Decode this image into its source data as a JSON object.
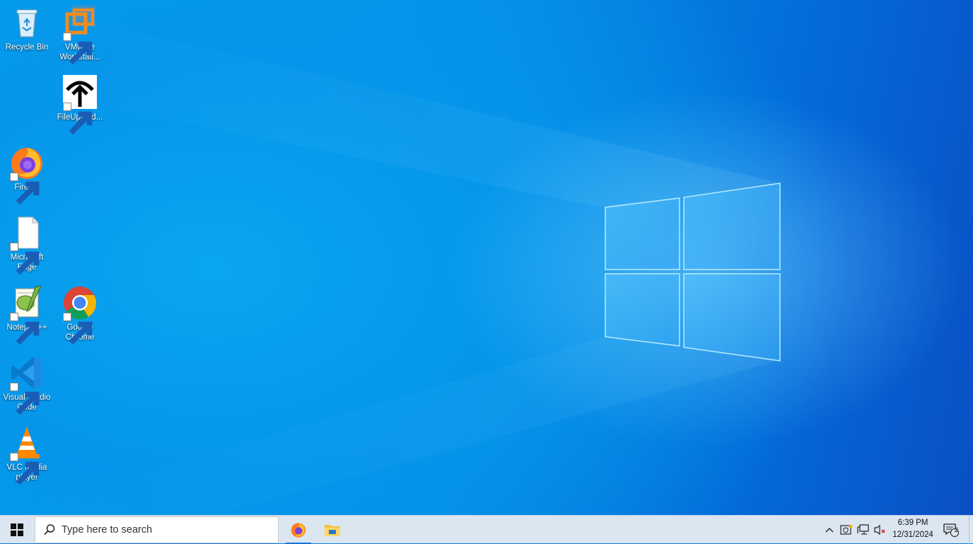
{
  "desktop": {
    "icons": [
      {
        "id": "recycle-bin",
        "label": "Recycle Bin"
      },
      {
        "id": "vmware",
        "label": "VMware Workstati..."
      },
      {
        "id": "fileupload",
        "label": "FileUpload..."
      },
      {
        "id": "firefox",
        "label": "Firefox"
      },
      {
        "id": "edge",
        "label": "Microsoft Edge"
      },
      {
        "id": "notepadpp",
        "label": "Notepad++"
      },
      {
        "id": "chrome",
        "label": "Google Chrome"
      },
      {
        "id": "vscode",
        "label": "Visual Studio Code"
      },
      {
        "id": "vlc",
        "label": "VLC media player"
      }
    ]
  },
  "taskbar": {
    "search_placeholder": "Type here to search",
    "pinned": [
      "firefox-icon",
      "file-explorer-icon"
    ],
    "tray_icons": [
      "chevron-up-icon",
      "security-center-icon",
      "network-icon",
      "volume-muted-icon"
    ],
    "time": "6:39 PM",
    "date": "12/31/2024",
    "notification_count": "2"
  },
  "colors": {
    "taskbar_bg": "#dbe6f1",
    "desktop_accent": "#0a7fe0"
  }
}
